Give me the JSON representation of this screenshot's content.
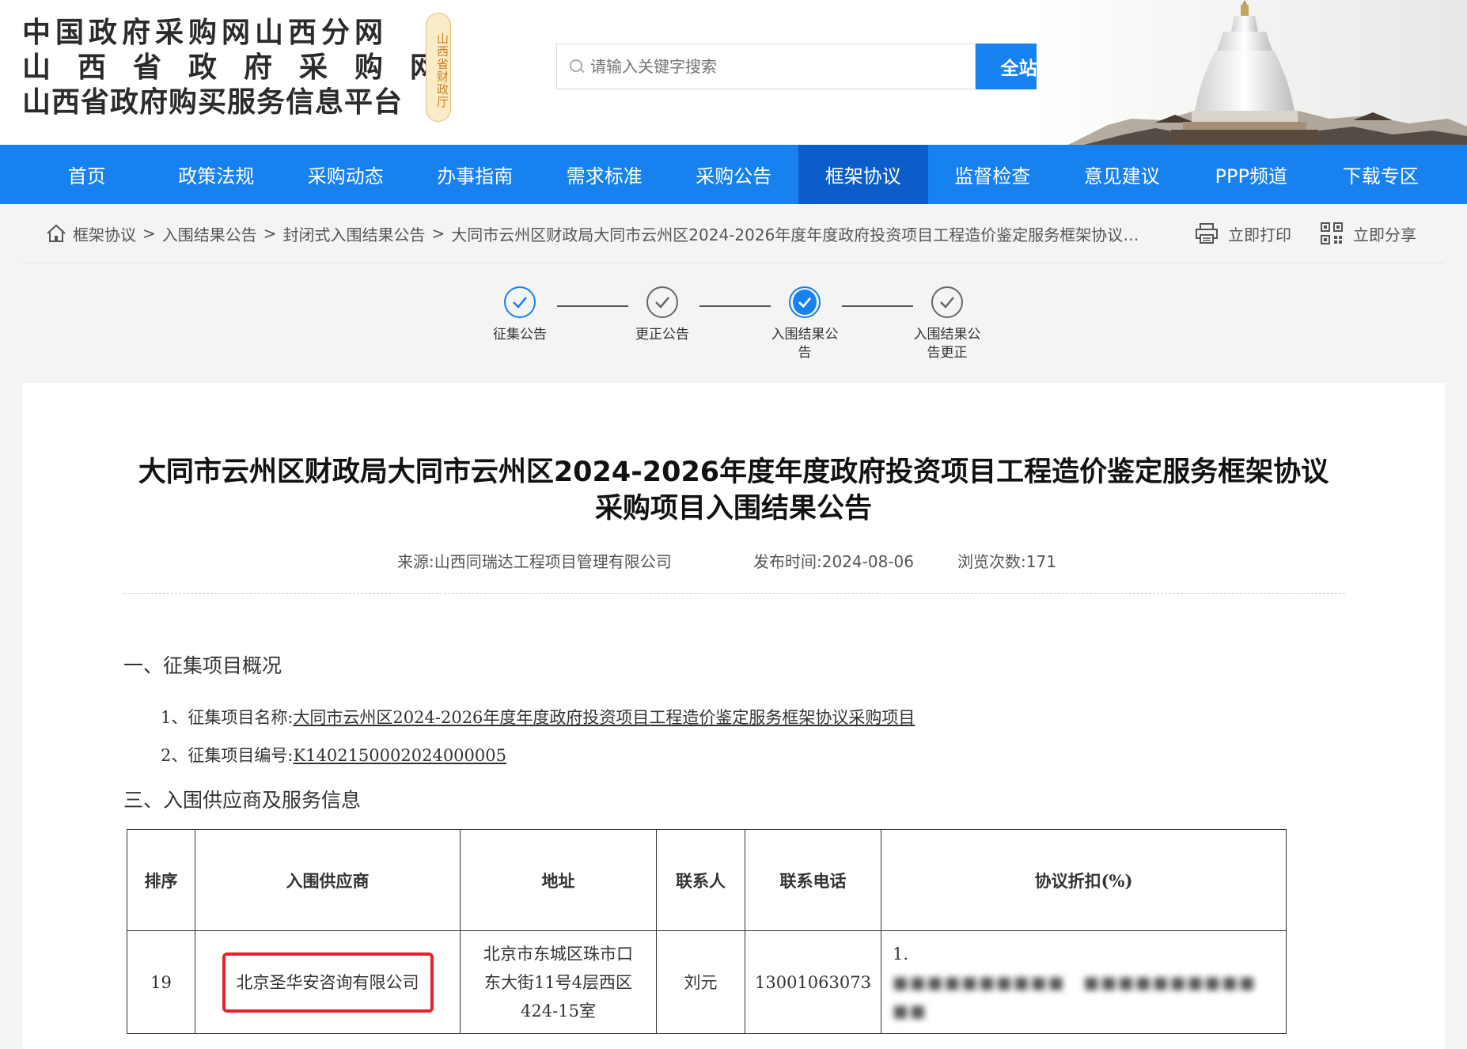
{
  "header": {
    "site_title_1": "中国政府采购网山西分网",
    "site_title_2": "山西省政府采购网",
    "site_title_3": "山西省政府购买服务信息平台",
    "seal_text": "山西省财政厅",
    "search_placeholder": "请输入关键字搜索",
    "search_button": "全站搜索"
  },
  "nav": {
    "items": [
      "首页",
      "政策法规",
      "采购动态",
      "办事指南",
      "需求标准",
      "采购公告",
      "框架协议",
      "监督检查",
      "意见建议",
      "PPP频道",
      "下载专区"
    ],
    "active_index": 6
  },
  "breadcrumb": {
    "items": [
      "框架协议",
      "入围结果公告",
      "封闭式入围结果公告"
    ],
    "current": "大同市云州区财政局大同市云州区2024-2026年度年度政府投资项目工程造价鉴定服务框架协议采购项目入围结果公告",
    "separator": ">",
    "print_label": "立即打印",
    "share_label": "立即分享"
  },
  "steps": [
    {
      "label": "征集公告",
      "state": "done"
    },
    {
      "label": "更正公告",
      "state": "done-gray"
    },
    {
      "label": "入围结果公告",
      "state": "current"
    },
    {
      "label": "入围结果公告更正",
      "state": "done-gray"
    }
  ],
  "article": {
    "title_line1": "大同市云州区财政局大同市云州区2024-2026年度年度政府投资项目工程造价鉴定服务框架协议",
    "title_line2": "采购项目入围结果公告",
    "source_label": "来源:",
    "source": "山西同瑞达工程项目管理有限公司",
    "date_label": "发布时间:",
    "date": "2024-08-06",
    "views_label": "浏览次数:",
    "views": "171",
    "section1": "一、征集项目概况",
    "item1_label": "1、征集项目名称:",
    "item1_value": "大同市云州区2024-2026年度年度政府投资项目工程造价鉴定服务框架协议采购项目",
    "item2_label": "2、征集项目编号:",
    "item2_value": "K1402150002024000005",
    "section3": "三、入围供应商及服务信息"
  },
  "table": {
    "headers": [
      "排序",
      "入围供应商",
      "地址",
      "联系人",
      "联系电话",
      "协议折扣(%)"
    ],
    "rows": [
      {
        "rank": "19",
        "supplier": "北京圣华安咨询有限公司",
        "address_l1": "北京市东城区珠市口",
        "address_l2": "东大街11号4层西区",
        "address_l3": "424-15室",
        "contact": "刘元",
        "phone": "13001063073",
        "discount": "1."
      }
    ]
  },
  "colors": {
    "nav_blue": "#1781f0",
    "nav_active": "#0b5ec9",
    "highlight_red": "#e8222a"
  }
}
